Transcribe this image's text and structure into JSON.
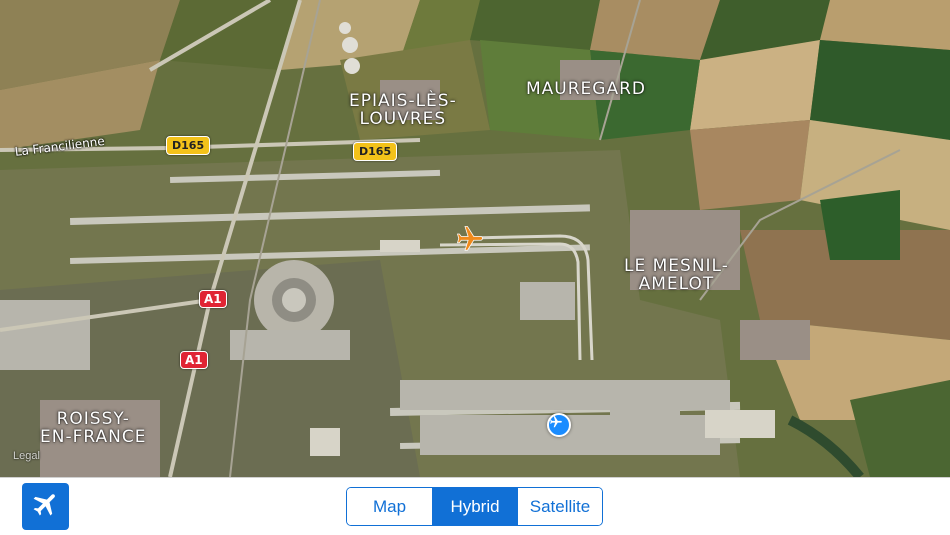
{
  "map": {
    "type": "Hybrid",
    "places": {
      "epiais": "Epiais-lès-\nLouvres",
      "mauregard": "Mauregard",
      "mesnil": "Le Mesnil-\nAmelot",
      "roissy": "Roissy-\nen-France"
    },
    "roads": {
      "francilienne": "La Francilienne",
      "d165_a": "D165",
      "d165_b": "D165",
      "a1_a": "A1",
      "a1_b": "A1"
    },
    "legal": "Legal",
    "icons": {
      "plane": "orange-plane-icon",
      "airport": "airport-pin-icon"
    },
    "colors": {
      "plane": "#f08a1c",
      "airport": "#1a8cff",
      "accent": "#1170d6",
      "road_shield": "#f3c21a",
      "motorway_shield": "#e02434"
    }
  },
  "toolbar": {
    "flight_button_icon": "airplane-icon",
    "segments": [
      "Map",
      "Hybrid",
      "Satellite"
    ],
    "selected": "Hybrid"
  }
}
